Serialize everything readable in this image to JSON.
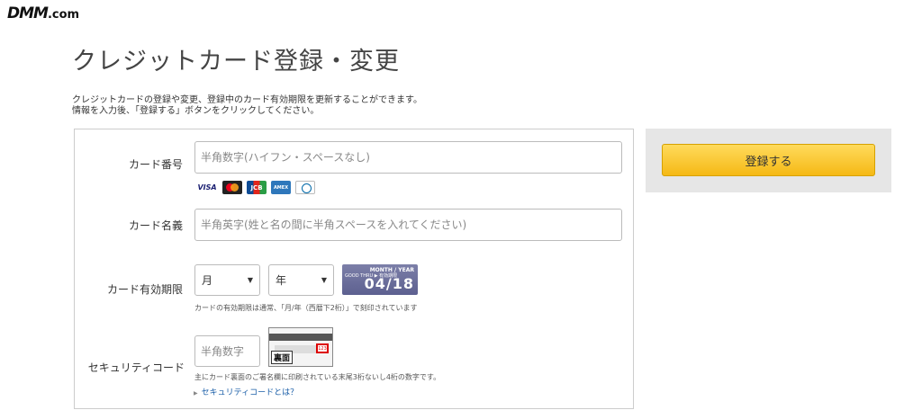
{
  "logo": {
    "main": "DMM",
    "sub": ".com"
  },
  "title": "クレジットカード登録・変更",
  "intro": [
    "クレジットカードの登録や変更、登録中のカード有効期限を更新することができます。",
    "情報を入力後、「登録する」ボタンをクリックしてください。"
  ],
  "form": {
    "card_number": {
      "label": "カード番号",
      "placeholder": "半角数字(ハイフン・スペースなし)"
    },
    "card_brands": [
      "VISA",
      "MC",
      "JCB",
      "AMEX",
      "Diners"
    ],
    "card_name": {
      "label": "カード名義",
      "placeholder": "半角英字(姓と名の間に半角スペースを入れてください)"
    },
    "expiry": {
      "label": "カード有効期限",
      "month_value": "月",
      "year_value": "年",
      "image_month_year": "MONTH / YEAR",
      "image_good_thru": "GOOD THRU ▶ 有効期限",
      "image_date": "04/18",
      "note": "カードの有効期限は通常、「月/年（西暦下2桁）」で刻印されています"
    },
    "security": {
      "label": "セキュリティコード",
      "placeholder": "半角数字",
      "image_code": "123",
      "image_tag": "裏面",
      "note": "主にカード裏面のご署名欄に印刷されている末尾3桁ないし4桁の数字です。",
      "link": "セキュリティコードとは？"
    }
  },
  "submit_label": "登録する"
}
